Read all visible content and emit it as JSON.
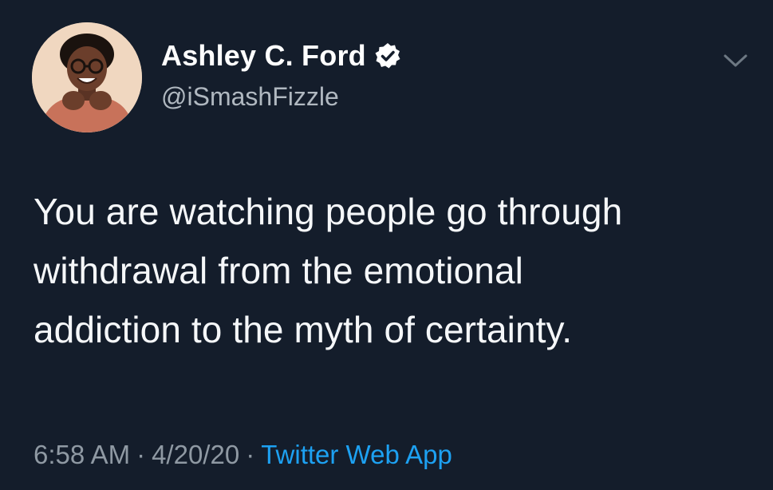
{
  "tweet": {
    "author": {
      "display_name": "Ashley C. Ford",
      "handle": "@iSmashFizzle",
      "verified": true,
      "avatar_icon": "profile-photo"
    },
    "text_lines": [
      "You are watching people go through",
      "withdrawal from the emotional",
      "addiction to the myth of certainty."
    ],
    "time": "6:58 AM",
    "separator": "·",
    "date": "4/20/20",
    "source": "Twitter Web App"
  },
  "icons": {
    "verified": "verified-badge-icon",
    "menu": "chevron-down-icon"
  },
  "colors": {
    "background": "#141d2b",
    "text": "#ffffff",
    "secondary_text": "#8f99a3",
    "link": "#1da1f2"
  }
}
